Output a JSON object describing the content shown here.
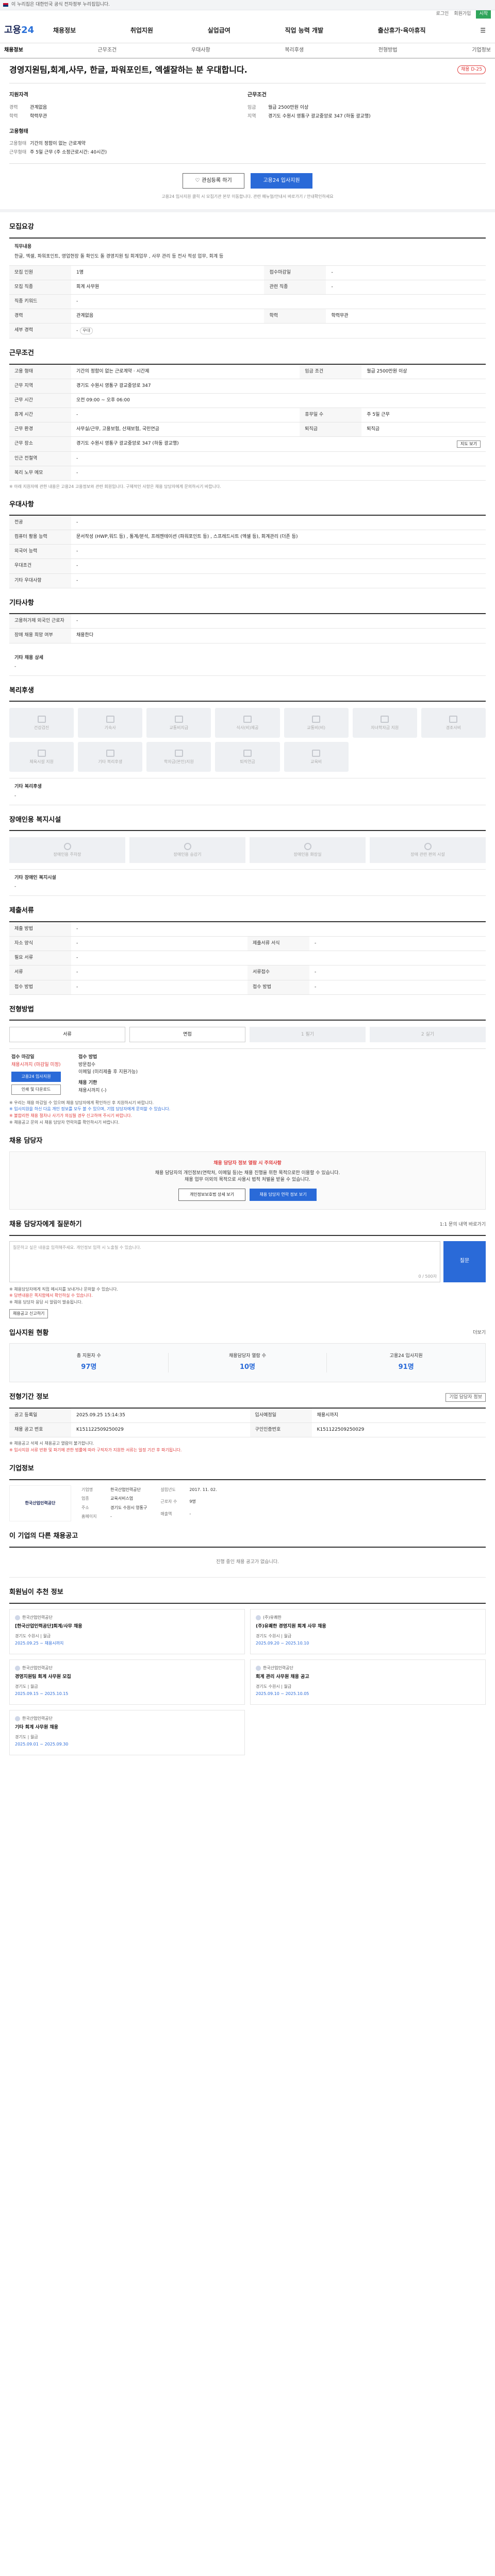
{
  "topbar": {
    "notice": "이 누리집은 대한민국 공식 전자정부 누리집입니다."
  },
  "topbar2": {
    "login": "로그인",
    "join": "회원가입",
    "start": "시작"
  },
  "header": {
    "logo_main": "고용",
    "logo_num": "24",
    "nav": [
      "채용정보",
      "취업지원",
      "실업급여",
      "직업 능력 개발",
      "출산휴가·육아휴직"
    ]
  },
  "tabs": [
    "채용정보",
    "근무조건",
    "우대사항",
    "복리후생",
    "전형방법",
    "기업정보"
  ],
  "job": {
    "company": "",
    "title": "경영지원팀,회계,사무, 한글, 파워포인트, 엑셀잘하는 분 우대합니다.",
    "badge": "채용 D-25",
    "left_header": "지원자격",
    "left_rows": [
      {
        "k": "경력",
        "v": "관계없음"
      },
      {
        "k": "학력",
        "v": "학력무관"
      }
    ],
    "left_header2": "고용형태",
    "left_rows2": [
      {
        "k": "고용형태",
        "v": "기간의 정함이 없는 근로계약"
      },
      {
        "k": "근무형태",
        "v": "주 5일 근무 (주 소정근로시간: 40시간)"
      }
    ],
    "right_header": "근무조건",
    "right_rows": [
      {
        "k": "임금",
        "v": "월급 2500만원 이상"
      },
      {
        "k": "지역",
        "v": "경기도 수원시 영통구 광교중앙로 347 (하동 광교행)"
      }
    ],
    "btn_save": "관심등록 하기",
    "btn_apply": "고용24 입사지원",
    "note": "고용24 입사지원 클릭 시 모집기관 본부 이동합니다. 관련 매뉴얼/안내서 바로가기 / 안내확인하세요"
  },
  "recruit": {
    "section": "모집요강",
    "desc_label": "직무내용",
    "desc": "한글, 엑셀, 파워포인트, 영업현장 돌 확인도 돌 경영지원 팀 회계업무 , 사무 관리 등 전사 적성 업무, 회계 등",
    "rows": [
      {
        "k1": "모집 인원",
        "v1": "1명",
        "k2": "접수마감일",
        "v2": "-"
      },
      {
        "k1": "모집 직종",
        "v1": "회계 사무원",
        "k2": "관련 직종",
        "v2": "-"
      },
      {
        "k1": "직종 키워드",
        "v1": "-",
        "k2": "",
        "v2": ""
      },
      {
        "k1": "경력",
        "v1": "관계없음",
        "k2": "학력",
        "v2": "학력무관"
      },
      {
        "k1": "세부 경력",
        "v1": "-",
        "k2": "",
        "v2": ""
      }
    ],
    "tag": "우대"
  },
  "work": {
    "section": "근무조건",
    "rows": [
      {
        "k1": "고용 형태",
        "v1": "기간의 정함이 없는 근로계약 · 시간제",
        "k2": "임금 조건",
        "v2": "월급 2500만원 이상"
      },
      {
        "k1": "근무 지역",
        "v1": "경기도 수원시 영통구 광교중앙로 347",
        "k2": "",
        "v2": ""
      },
      {
        "k1": "근무 시간",
        "v1": "오전 09:00 ~ 오후 06:00",
        "k2": "",
        "v2": ""
      },
      {
        "k1": "휴게 시간",
        "v1": "-",
        "k2": "휴무일 수",
        "v2": "주 5일 근무"
      },
      {
        "k1": "근무 환경",
        "v1": "사무실/근무, 고용보험, 산재보험, 국민연금",
        "k2": "퇴직금",
        "v2": "퇴직금"
      },
      {
        "k1": "근무 장소",
        "v1": "경기도 수원시 영통구 광교중앙로 347 (하동 광교행)",
        "k2": "",
        "v2": ""
      },
      {
        "k1": "인근 전철역",
        "v1": "-",
        "k2": "",
        "v2": ""
      },
      {
        "k1": "복리 노무 메모",
        "v1": "-",
        "k2": "",
        "v2": ""
      }
    ],
    "map_btn": "지도 보기",
    "note": "※ 아래 지원자에 관한 내용은 고용24 고용정보와 관련 회원입니다. 구체적인 사항은 채용 담당자에게 문의하시기 바랍니다."
  },
  "prefer": {
    "section": "우대사항",
    "rows": [
      {
        "k": "전공",
        "v": "-"
      },
      {
        "k": "컴퓨터 활용 능력",
        "v": "문서작성 (HWP,워드 등) , 통계/분석, 프레젠테이션 (파워포인트 등) , 스프레드시트 (엑셀 등), 회계관리 (더존 등)"
      },
      {
        "k": "외국어 능력",
        "v": "-"
      },
      {
        "k": "우대조건",
        "v": "-"
      },
      {
        "k": "기타 우대사항",
        "v": "-"
      }
    ]
  },
  "other": {
    "section": "기타사항",
    "rows": [
      {
        "k": "고용허가제 외국인 근로자",
        "v": "-"
      },
      {
        "k": "장애 채용 희망 여부",
        "v": "채용한다"
      }
    ],
    "sub_label": "기타 채용 상세",
    "sub_value": "-"
  },
  "welfare": {
    "section": "복리후생",
    "items": [
      "건강검진",
      "기숙사",
      "교통비지급",
      "식사(비)제공",
      "교통비(비)",
      "자녀학자금 지원",
      "경조사비",
      "체육시설 지원",
      "기타 복리후생",
      "학자금(본인)지원",
      "퇴직연금",
      "교육비"
    ],
    "sub_label": "기타 복리후생",
    "sub_value": "-"
  },
  "disabled": {
    "section": "장애인용 복지시설",
    "items": [
      "장애인용 주차장",
      "장애인용 승강기",
      "장애인용 화장실",
      "장애 관련 편의 시설"
    ],
    "sub_label": "기타 장애인 복지시설",
    "sub_value": "-"
  },
  "apply": {
    "section": "제출서류",
    "rows": [
      {
        "k1": "제출 방법",
        "v1": "-",
        "k2": "",
        "v2": ""
      },
      {
        "k1": "자소 양식",
        "v1": "-",
        "k2": "제출서류 서식",
        "v2": "-"
      },
      {
        "k1": "필요 서류",
        "v1": "-",
        "k2": "",
        "v2": ""
      },
      {
        "k1": "서류",
        "v1": "-",
        "k2": "서류접수",
        "v2": "-"
      },
      {
        "k1": "접수 방법",
        "v1": "-",
        "k2": "접수 방법",
        "v2": "-"
      }
    ]
  },
  "process": {
    "section": "전형방법",
    "steps": [
      "서류",
      "면접",
      "1 필기",
      "2 실기"
    ],
    "c1_label": "접수 마감일",
    "c1_value": "채용시까지 (마감일 미정)",
    "c1_blue": "고용24 입사지원",
    "c1_out": "인쇄 및 다운로드",
    "c2_label": "접수 방법",
    "c2_v1": "방문접수",
    "c2_v2": "이메일 (미리제출 후 지원가능)",
    "c2_label2": "채용 기한",
    "c2_v3": "채용시까지 (-)",
    "bullets": [
      "※ 우리는 채용 마감일 수 있으며 채용 담당자에게 확인하신 후 지원하시기 바랍니다.",
      "※ 입사지원을 하신 다음 개인 정보를 모두 볼 수 있으며, 기업 담당자에게 문의할 수 있습니다.",
      "※ 불합리한 채용 절차나 사기가 의심될 경우 신고하여 주시기 바랍니다.",
      "※ 채용공고 문의 시 채용 담당자 연락처를 확인하시기 바랍니다."
    ]
  },
  "contact": {
    "section": "채용 담당자",
    "title": "채용 담당자 정보 열람 시 주의사항",
    "l1": "채용 담당자의 개인정보(연락처, 이메일 등)는 채용 진행을 위한 목적으로만 이용할 수 있습니다.",
    "l2": "채용 업무 이외의 목적으로 사용시 법적 처벌을 받을 수 있습니다.",
    "btn1": "개인정보보호법 상세 보기",
    "btn2": "채용 담당자 연락 정보 보기"
  },
  "ask": {
    "section": "채용 담당자에게 질문하기",
    "right": "1:1 문의 내역 바로가기",
    "placeholder": "질문하고 싶은 내용을 입력해주세요. 개인정보 입력 시 노출될 수 있습니다.",
    "count": "0 / 500자",
    "btn": "질문",
    "bullets": [
      "※ 채용담당자에게 직접 메시지를 보내거나 문의할 수 있습니다.",
      "※ 답변내용은 쪽지함에서 확인하실 수 있습니다.",
      "※ 채용 담당자 응답 시 알림이 발송됩니다."
    ],
    "report_btn": "채용공고 신고하기"
  },
  "stats": {
    "section": "입사지원 현황",
    "right": "더보기",
    "items": [
      {
        "l": "총 지원자 수",
        "n": "97명"
      },
      {
        "l": "채용담당자 열람 수",
        "n": "10명"
      },
      {
        "l": "고용24 입사지원",
        "n": "91명"
      }
    ]
  },
  "periods": {
    "section": "전형기간 정보",
    "right": "기업 담당자 정보",
    "rows": [
      {
        "k1": "공고 등록일",
        "v1": "2025.09.25 15:14:35",
        "k2": "입사예정일",
        "v2": "채용시까지"
      },
      {
        "k1": "채용 공고 번호",
        "v1": "K151122509250029",
        "k2": "구인인증번호",
        "v2": "K151122509250029"
      }
    ],
    "note1": "※ 채용공고 삭제 시 채용공고 열람이 불가합니다.",
    "note2": "※ 입사지원 서류 반환 및 파기에 관한 법률에 따라 구직자가 지원한 서류는 일정 기간 후 파기됩니다."
  },
  "company": {
    "section": "기업정보",
    "logo_text": "한국산업인력공단",
    "rows": [
      {
        "k": "기업명",
        "v": "한국산업인력공단"
      },
      {
        "k": "업종",
        "v": "교육서비스업"
      },
      {
        "k": "주소",
        "v": "경기도 수원시 영통구"
      },
      {
        "k": "홈페이지",
        "v": "-"
      }
    ],
    "rows2": [
      {
        "k": "설립년도",
        "v": "2017. 11. 02."
      },
      {
        "k": "근로자 수",
        "v": "9명"
      },
      {
        "k": "매출액",
        "v": "-"
      }
    ]
  },
  "alljobs": {
    "section": "이 기업의 다른 채용공고",
    "empty": "진행 중인 채용 공고가 없습니다."
  },
  "rec": {
    "section": "회원님이 추천 정보",
    "items": [
      {
        "co": "한국산업인력공단",
        "title": "[한국산업인력공단]회계/사무 채용",
        "meta": "경기도 수원시 | 월급",
        "date": "2025.09.25 ~ 채용시까지"
      },
      {
        "co": "(주)유쾌한",
        "title": "(주)유쾌한 경영지원 회계 사무 채용",
        "meta": "경기도 수원시 | 월급",
        "date": "2025.09.20 ~ 2025.10.10"
      },
      {
        "co": "한국산업인력공단",
        "title": "경영지원팀 회계 사무원 모집",
        "meta": "경기도 | 월급",
        "date": "2025.09.15 ~ 2025.10.15"
      },
      {
        "co": "한국산업인력공단",
        "title": "회계 관리 사무원 채용 공고",
        "meta": "경기도 수원시 | 월급",
        "date": "2025.09.10 ~ 2025.10.05"
      },
      {
        "co": "한국산업인력공단",
        "title": "기타 회계 사무원 채용",
        "meta": "경기도 | 월급",
        "date": "2025.09.01 ~ 2025.09.30"
      }
    ]
  }
}
